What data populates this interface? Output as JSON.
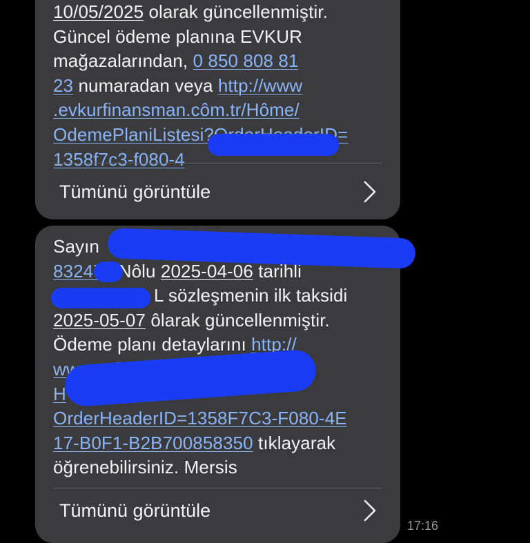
{
  "messages": [
    {
      "id": "top",
      "lines": [
        [
          {
            "t": "10/05/2025",
            "k": "d"
          },
          {
            "t": " olarak güncellenmiştir.",
            "k": "p"
          }
        ],
        [
          {
            "t": "Güncel ödeme planına EVKUR",
            "k": "p"
          }
        ],
        [
          {
            "t": "mağazalarından, ",
            "k": "p"
          },
          {
            "t": "0 850 808 81",
            "k": "l"
          }
        ],
        [
          {
            "t": "23",
            "k": "l"
          },
          {
            "t": " numaradan veya ",
            "k": "p"
          },
          {
            "t": "http://www",
            "k": "l"
          }
        ],
        [
          {
            "t": ".evkurfinansman.côm.tr/Hôme/",
            "k": "l"
          }
        ],
        [
          {
            "t": "OdemePlaniListesi?OrderHeaderID=",
            "k": "l"
          }
        ],
        [
          {
            "t": "1358f7c3-f080-4",
            "k": "l"
          }
        ]
      ],
      "view_all_label": "Tümünü görüntüle"
    },
    {
      "id": "bottom",
      "lines": [
        [
          {
            "t": "Sayın",
            "k": "p"
          }
        ],
        [
          {
            "t": "8324",
            "k": "l"
          },
          {
            "t": "73",
            "k": "l"
          },
          {
            "t": " Nôlu ",
            "k": "p"
          },
          {
            "t": "2025-04-06",
            "k": "d"
          },
          {
            "t": " tarihli",
            "k": "p"
          }
        ],
        [
          {
            "t": "L sözleşmenin ilk taksidi",
            "k": "p",
            "pad": 146
          }
        ],
        [
          {
            "t": "2025-05-07",
            "k": "d"
          },
          {
            "t": " ôlarak güncellenmiştir.",
            "k": "p"
          }
        ],
        [
          {
            "t": "Ödeme planı detaylarını ",
            "k": "p"
          },
          {
            "t": "http://",
            "k": "l"
          }
        ],
        [
          {
            "t": "www.evkurfi",
            "k": "l"
          },
          {
            "t": "/",
            "k": "l",
            "pad": 230
          }
        ],
        [
          {
            "t": "H",
            "k": "l"
          }
        ],
        [
          {
            "t": "OrderHeaderID=1358F7C3-F080-4E",
            "k": "l"
          }
        ],
        [
          {
            "t": "17-B0F1-B2B700858350",
            "k": "l"
          },
          {
            "t": " tıklayarak",
            "k": "p"
          }
        ],
        [
          {
            "t": "öğrenebilirsiniz. Mersis",
            "k": "p"
          }
        ]
      ],
      "view_all_label": "Tümünü görüntüle"
    }
  ],
  "timestamp": "17:16",
  "colors": {
    "background": "#000000",
    "bubble": "#3b3b3d",
    "link": "#8ab4f8",
    "text": "#f2f2f2",
    "redaction": "#1a3cf5"
  },
  "icons": {
    "view_all": "chevron-right-icon"
  }
}
